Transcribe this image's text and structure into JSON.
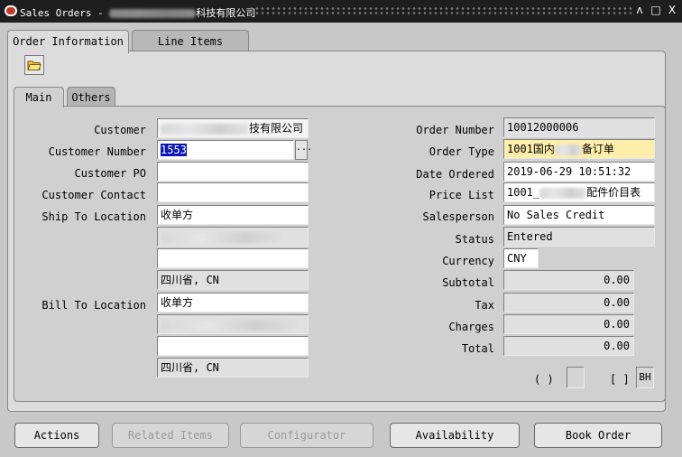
{
  "window": {
    "title_prefix": "Sales Orders - ",
    "title_suffix": "科技有限公司",
    "controls": [
      "ʌ",
      "□",
      "X"
    ]
  },
  "outer_tabs": [
    {
      "label": "Order Information",
      "active": true
    },
    {
      "label": "Line Items",
      "active": false
    }
  ],
  "inner_tabs": [
    {
      "label": "Main",
      "active": true
    },
    {
      "label": "Others",
      "active": false
    }
  ],
  "left_form": {
    "customer_label": "Customer",
    "customer_value_suffix": "技有限公司",
    "customer_number_label": "Customer Number",
    "customer_number_value": "1553",
    "customer_po_label": "Customer PO",
    "customer_po_value": "",
    "customer_contact_label": "Customer Contact",
    "customer_contact_value": "",
    "ship_to_label": "Ship To Location",
    "ship_to_value": "收单方",
    "ship_to_region": "四川省, CN",
    "bill_to_label": "Bill To Location",
    "bill_to_value": "收单方",
    "bill_to_region": "四川省, CN"
  },
  "right_form": {
    "order_number_label": "Order Number",
    "order_number_value": "10012000006",
    "order_type_label": "Order Type",
    "order_type_prefix": "1001国内",
    "order_type_suffix": "备订单",
    "date_ordered_label": "Date Ordered",
    "date_ordered_value": "2019-06-29 10:51:32",
    "price_list_label": "Price List",
    "price_list_prefix": "1001_",
    "price_list_suffix": "配件价目表",
    "salesperson_label": "Salesperson",
    "salesperson_value": "No Sales Credit",
    "status_label": "Status",
    "status_value": "Entered",
    "currency_label": "Currency",
    "currency_value": "CNY",
    "subtotal_label": "Subtotal",
    "subtotal_value": "0.00",
    "tax_label": "Tax",
    "tax_value": "0.00",
    "charges_label": "Charges",
    "charges_value": "0.00",
    "total_label": "Total",
    "total_value": "0.00",
    "paren_indicator": "( )",
    "bracket_indicator": "[ ]",
    "bh_value": "BH"
  },
  "buttons": {
    "actions": "Actions",
    "related_items": "Related Items",
    "configurator": "Configurator",
    "availability": "Availability",
    "book_order": "Book Order"
  },
  "colors": {
    "title_bar": "#1e1e1e",
    "panel": "#dcdcdc",
    "selection": "#0a16b8",
    "required_field": "#fdeeaa"
  }
}
